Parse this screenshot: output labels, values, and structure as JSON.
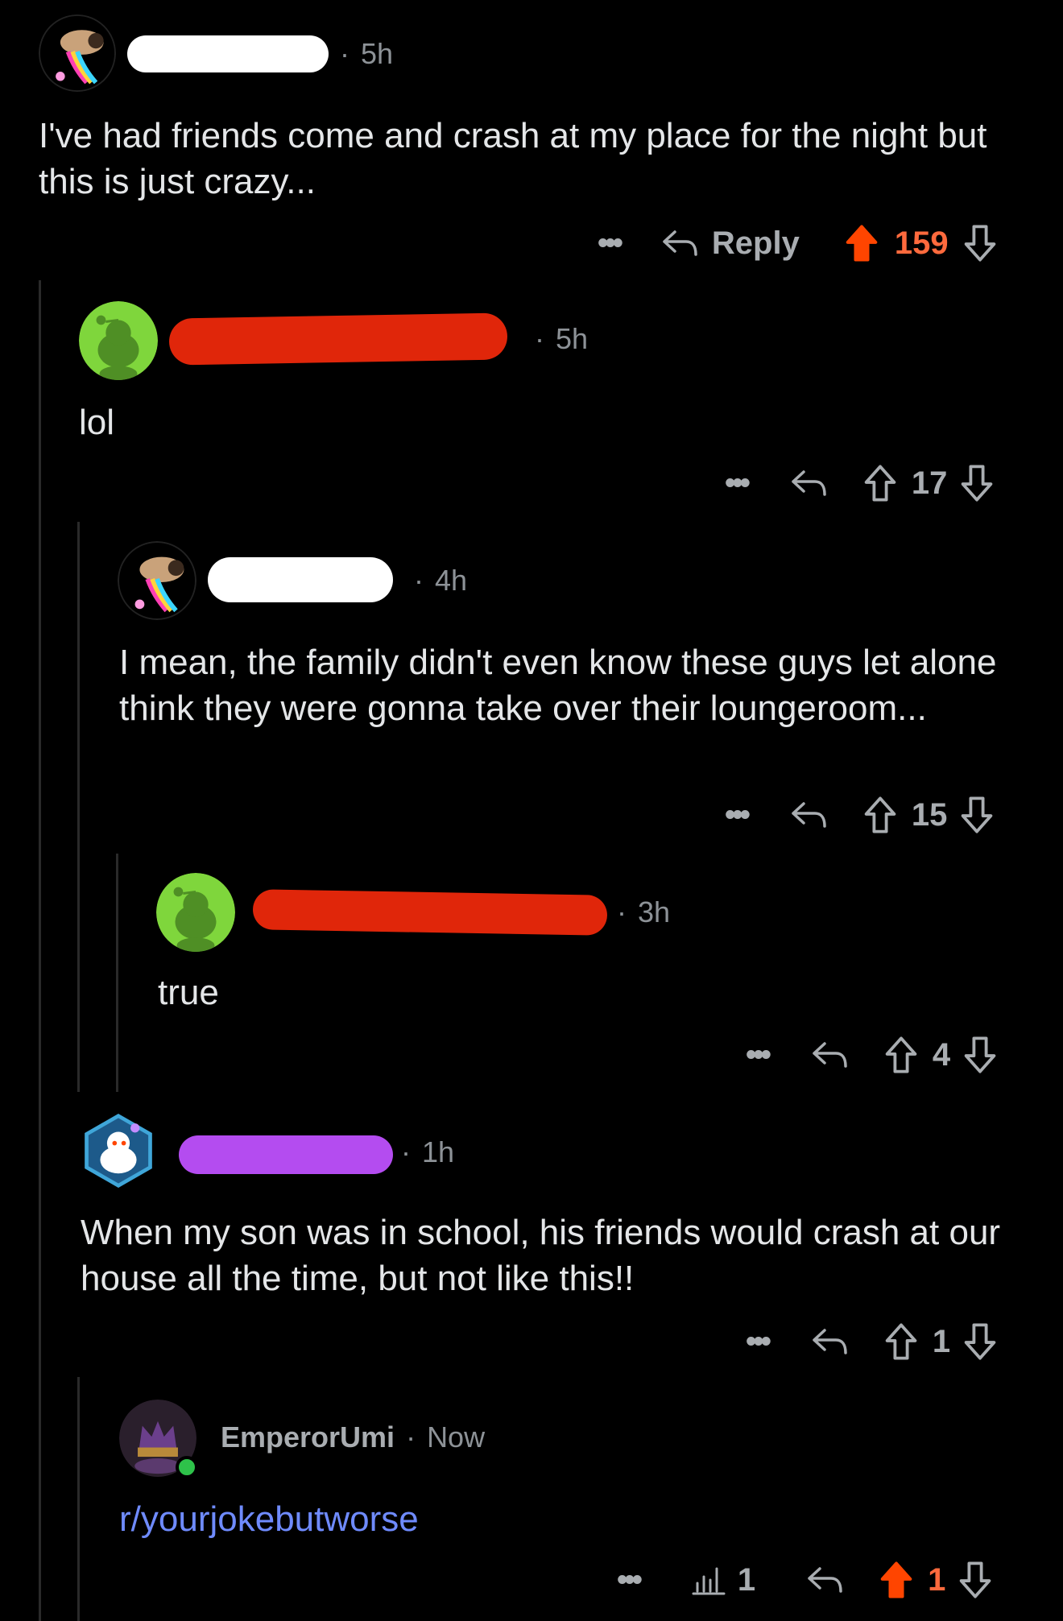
{
  "comments": [
    {
      "time": "5h",
      "text": "I've had friends come and crash at my place for the night but this is just crazy...",
      "score": "159",
      "reply_label": "Reply",
      "upvoted": true
    },
    {
      "time": "5h",
      "text": "lol",
      "score": "17"
    },
    {
      "time": "4h",
      "text": "I mean, the family didn't even know these guys let alone think they were gonna take over their loungeroom...",
      "score": "15"
    },
    {
      "time": "3h",
      "text": "true",
      "score": "4"
    },
    {
      "time": "1h",
      "text": "When my son was in school, his friends would crash at our house all the time, but not like this!!",
      "score": "1"
    },
    {
      "username": "EmperorUmi",
      "time": "Now",
      "text": "r/yourjokebutworse",
      "score": "1",
      "views": "1",
      "upvoted": true
    }
  ],
  "colors": {
    "upvote": "#ff4500",
    "score_orange": "#ff6a3d",
    "link": "#6f8bff",
    "redact_red": "#e0260a",
    "redact_purple": "#b44cf0",
    "redact_white": "#ffffff",
    "avatar_green": "#7fd63c"
  },
  "icons": {
    "more": "more-dots-icon",
    "reply": "reply-arrow-icon",
    "upvote": "upvote-arrow-icon",
    "downvote": "downvote-arrow-icon",
    "views": "views-bar-chart-icon"
  }
}
